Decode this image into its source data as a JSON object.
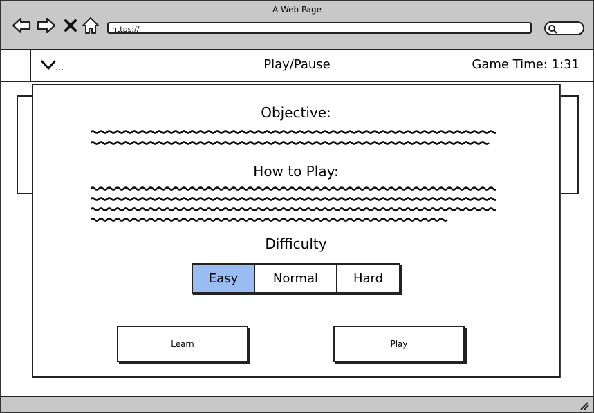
{
  "browser": {
    "window_title": "A Web Page",
    "url": "https://",
    "icons": [
      "back-arrow-icon",
      "forward-arrow-icon",
      "close-x-icon",
      "home-icon",
      "search-icon"
    ]
  },
  "topbar": {
    "menu_icon": "chevron-down-icon",
    "play_pause_label": "Play/Pause",
    "game_time_label": "Game Time: 1:31"
  },
  "modal": {
    "objective_heading": "Objective:",
    "how_to_play_heading": "How to Play:",
    "difficulty_heading": "Difficulty",
    "difficulty_options": [
      "Easy",
      "Normal",
      "Hard"
    ],
    "difficulty_selected": "Easy",
    "learn_button": "Learn",
    "play_button": "Play"
  },
  "colors": {
    "selected_option": "#99bdf3",
    "chrome_gray": "#c8c8c8"
  }
}
